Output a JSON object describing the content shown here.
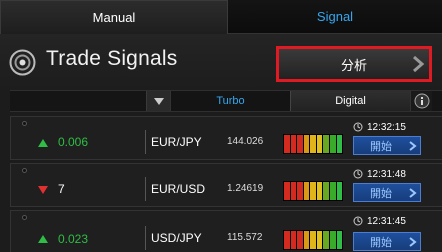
{
  "tabs": {
    "manual": "Manual",
    "signal": "Signal"
  },
  "header": {
    "title": "Trade Signals",
    "analyze_label": "分析"
  },
  "columns": {
    "turbo": "Turbo",
    "digital": "Digital"
  },
  "colors": {
    "accent_blue": "#35a7ef",
    "highlight_red": "#e01a22",
    "up_green": "#2fbd45",
    "down_red": "#e03131"
  },
  "signals": [
    {
      "direction": "up",
      "value": "0.006",
      "pair": "EUR/JPY",
      "price": "144.026",
      "time": "12:32:15",
      "button": "開始"
    },
    {
      "direction": "down",
      "value": "7",
      "pair": "EUR/USD",
      "price": "1.24619",
      "time": "12:31:48",
      "button": "開始"
    },
    {
      "direction": "up",
      "value": "0.023",
      "pair": "USD/JPY",
      "price": "115.572",
      "time": "12:31:45",
      "button": "開始"
    }
  ]
}
